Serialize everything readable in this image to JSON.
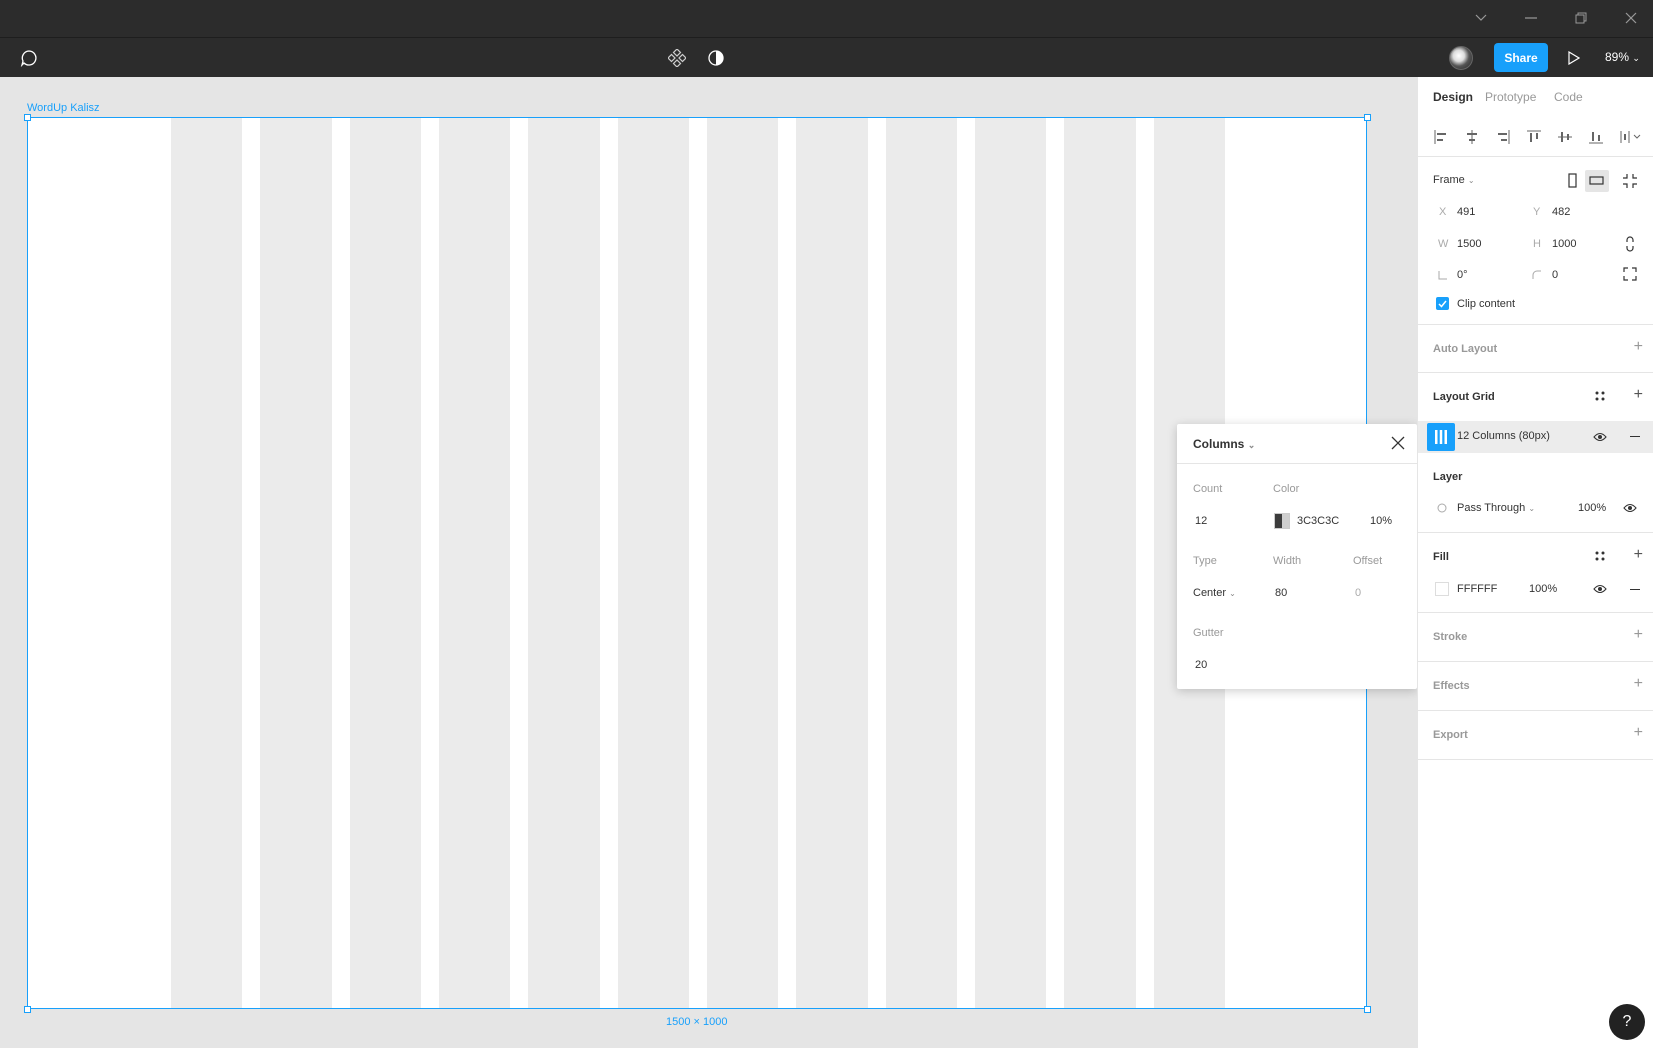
{
  "toolbar": {
    "share_label": "Share",
    "zoom": "89%"
  },
  "canvas": {
    "frame_name": "WordUp Kalisz",
    "frame_size_label": "1500 × 1000",
    "grid": {
      "count": 12,
      "column_width": 80,
      "gutter": 20,
      "type": "Center"
    }
  },
  "popup": {
    "title": "Columns",
    "count_label": "Count",
    "count_value": "12",
    "color_label": "Color",
    "color_value": "3C3C3C",
    "color_opacity": "10%",
    "type_label": "Type",
    "type_value": "Center",
    "width_label": "Width",
    "width_value": "80",
    "offset_label": "Offset",
    "offset_value": "0",
    "gutter_label": "Gutter",
    "gutter_value": "20"
  },
  "panel": {
    "tabs": [
      "Design",
      "Prototype",
      "Code"
    ],
    "frame_label": "Frame",
    "x_label": "X",
    "x_value": "491",
    "y_label": "Y",
    "y_value": "482",
    "w_label": "W",
    "w_value": "1500",
    "h_label": "H",
    "h_value": "1000",
    "rotation_value": "0°",
    "radius_value": "0",
    "clip_content_label": "Clip content",
    "auto_layout_label": "Auto Layout",
    "layout_grid_label": "Layout Grid",
    "layout_grid_item": "12 Columns (80px)",
    "layer_label": "Layer",
    "blend_mode": "Pass Through",
    "layer_opacity": "100%",
    "fill_label": "Fill",
    "fill_color": "FFFFFF",
    "fill_opacity": "100%",
    "stroke_label": "Stroke",
    "effects_label": "Effects",
    "export_label": "Export"
  },
  "help_label": "?",
  "colors": {
    "accent": "#18a0fb",
    "toolbar": "#2c2c2c",
    "grid": "#ebebeb"
  }
}
